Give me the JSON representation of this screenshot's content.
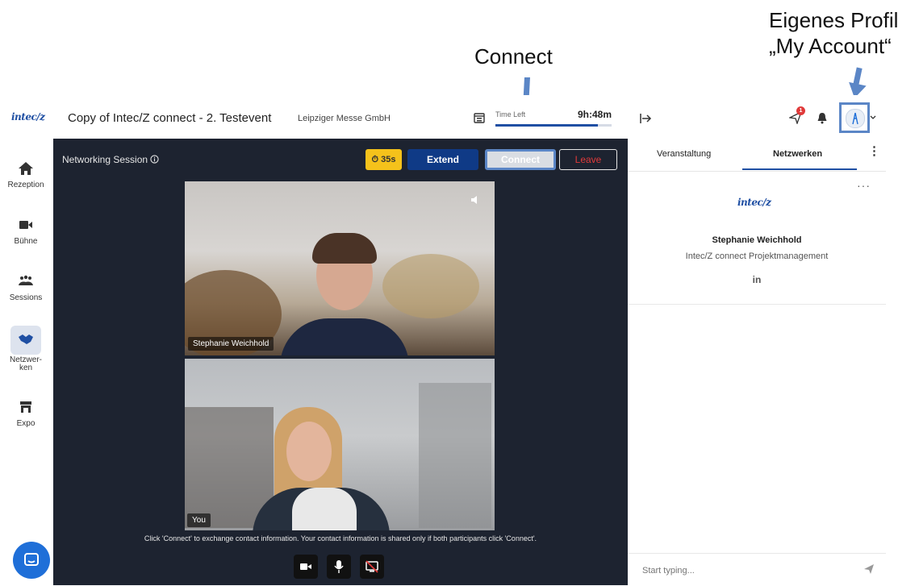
{
  "annotations": {
    "connect": "Connect",
    "profile_line1": "Eigenes Profil",
    "profile_line2": "„My Account“"
  },
  "header": {
    "logo": "intec/z",
    "event_title": "Copy of Intec/Z connect - 2. Testevent",
    "organizer": "Leipziger Messe GmbH",
    "time_left_label": "Time Left",
    "time_left_value": "9h:48m",
    "time_left_progress": 0.88
  },
  "sidebar": {
    "items": [
      {
        "label": "Rezeption",
        "icon": "home-icon"
      },
      {
        "label": "Bühne",
        "icon": "video-icon"
      },
      {
        "label": "Sessions",
        "icon": "people-icon"
      },
      {
        "label": "Netzwer-\nken",
        "icon": "handshake-icon",
        "active": true
      },
      {
        "label": "Expo",
        "icon": "store-icon"
      }
    ]
  },
  "session": {
    "title": "Networking Session",
    "timer": "35s",
    "extend_label": "Extend",
    "connect_label": "Connect",
    "leave_label": "Leave",
    "remote_name": "Stephanie Weichhold",
    "local_name": "You",
    "hint": "Click 'Connect' to exchange contact information. Your contact information is shared only if both participants click 'Connect'."
  },
  "right_panel": {
    "tabs": [
      "Veranstaltung",
      "Netzwerken"
    ],
    "active_tab": "Netzwerken",
    "notification_count": "1",
    "profile": {
      "logo": "intec/z",
      "name": "Stephanie Weichhold",
      "role": "Intec/Z connect Projektmanagement",
      "social": "in"
    },
    "chat_placeholder": "Start typing..."
  },
  "colors": {
    "brand_blue": "#1f4fa3",
    "extend_bg": "#0f3a86",
    "leave_red": "#e03a3a",
    "timer_yellow": "#f5c21b",
    "annotation_blue": "#5b86c6",
    "stage_bg": "#1d2330"
  }
}
